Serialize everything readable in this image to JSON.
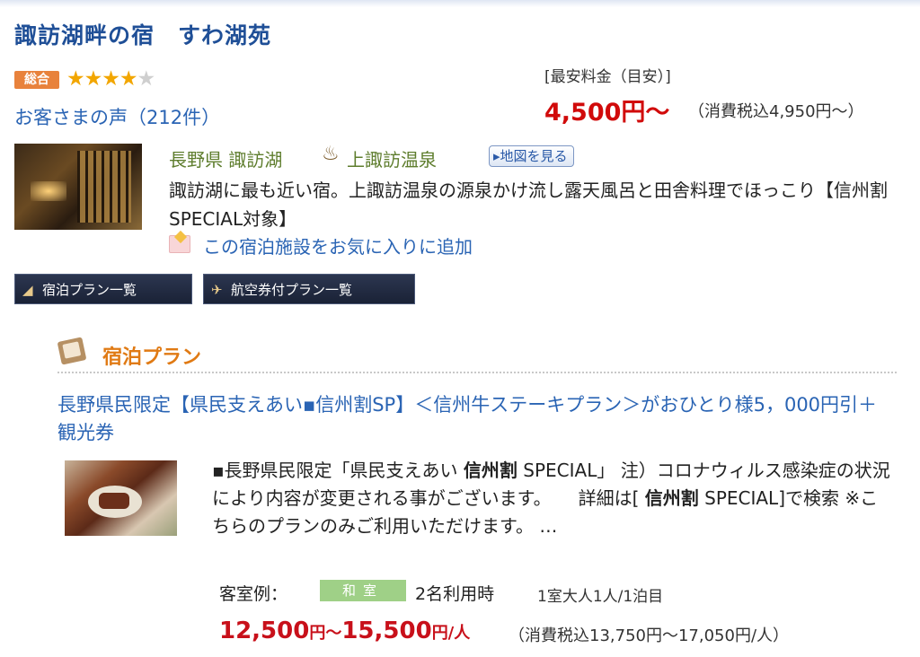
{
  "hotel": {
    "name": "諏訪湖畔の宿　すわ湖苑",
    "overall_badge": "総合",
    "rating": {
      "value": 4,
      "max": 5
    },
    "reviews_link": "お客さまの声（212件）",
    "location": "長野県 諏訪湖",
    "onsen_icon_glyph": "♨",
    "onsen": "上諏訪温泉",
    "map_button": "▸地図を見る",
    "description": "諏訪湖に最も近い宿。上諏訪温泉の源泉かけ流し露天風呂と田舎料理でほっこり【信州割SPECIAL対象】",
    "favorite_link": "この宿泊施設をお気に入りに追加"
  },
  "price": {
    "label": "[最安料金（目安）]",
    "main": "4,500円〜",
    "tax": "（消費税込4,950円〜）"
  },
  "tabs": [
    {
      "label": "宿泊プラン一覧",
      "icon": "pencil-icon",
      "glyph": "◢"
    },
    {
      "label": "航空券付プラン一覧",
      "icon": "airplane-icon",
      "glyph": "✈"
    }
  ],
  "plan_section": {
    "heading": "宿泊プラン",
    "plan_title": "長野県民限定【県民支えあい▪信州割SP】＜信州牛ステーキプラン＞がおひとり様5，000円引＋観光券",
    "description_parts": {
      "p1": "▪長野県民限定「県民支えあい ",
      "b1": "信州割",
      "p2": " SPECIAL」 注）コロナウィルス感染症の状況により内容が変更される事がございます。　　詳細は[ ",
      "b2": "信州割",
      "p3": " SPECIAL]で検索 ※こちらのプランのみご利用いただけます。 …"
    },
    "room_label": "客室例：",
    "room_type": "和室",
    "room_usage": "2名利用時",
    "room_occupancy": "1室大人1人/1泊目",
    "price_from": "12,500",
    "price_yen_sep": "円〜",
    "price_to": "15,500",
    "price_unit": "円/人",
    "price_tax": "（消費税込13,750円〜17,050円/人）"
  },
  "colors": {
    "title_blue": "#1f4f97",
    "link_blue": "#2a64b4",
    "price_red": "#d10a0a",
    "accent_orange": "#e07a14",
    "location_green": "#5e7d2d",
    "star_gold": "#f2a600"
  }
}
